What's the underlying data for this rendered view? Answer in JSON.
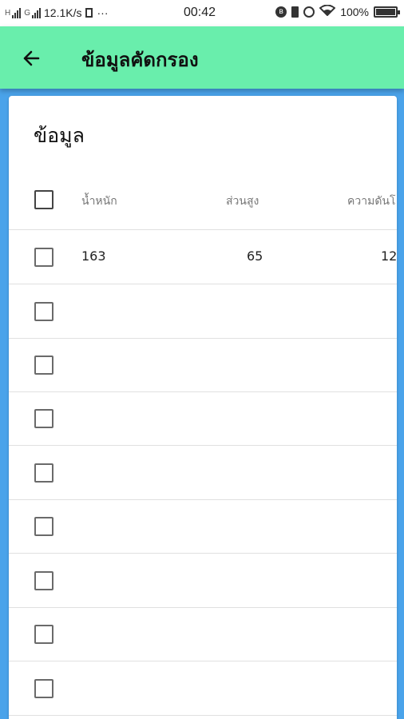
{
  "status_bar": {
    "network1": "H",
    "network2": "G",
    "speed": "12.1K/s",
    "dots": "···",
    "time": "00:42",
    "battery": "100%",
    "icons": [
      "bluetooth-icon",
      "battery-saver-icon",
      "alarm-icon",
      "wifi-icon",
      "battery-icon"
    ]
  },
  "appbar": {
    "title": "ข้อมูลคัดกรอง",
    "back_icon": "arrow-back-icon",
    "color": "#69eeac"
  },
  "card": {
    "title": "ข้อมูล",
    "columns": [
      "น้ำหนัก",
      "ส่วนสูง",
      "ความดันโ"
    ],
    "rows": [
      [
        "163",
        "65",
        "12"
      ],
      [
        "",
        "",
        ""
      ],
      [
        "",
        "",
        ""
      ],
      [
        "",
        "",
        ""
      ],
      [
        "",
        "",
        ""
      ],
      [
        "",
        "",
        ""
      ],
      [
        "",
        "",
        ""
      ],
      [
        "",
        "",
        ""
      ],
      [
        "",
        "",
        ""
      ]
    ]
  },
  "colors": {
    "background": "#4aa3ea",
    "appbar": "#69eeac",
    "card": "#ffffff"
  }
}
